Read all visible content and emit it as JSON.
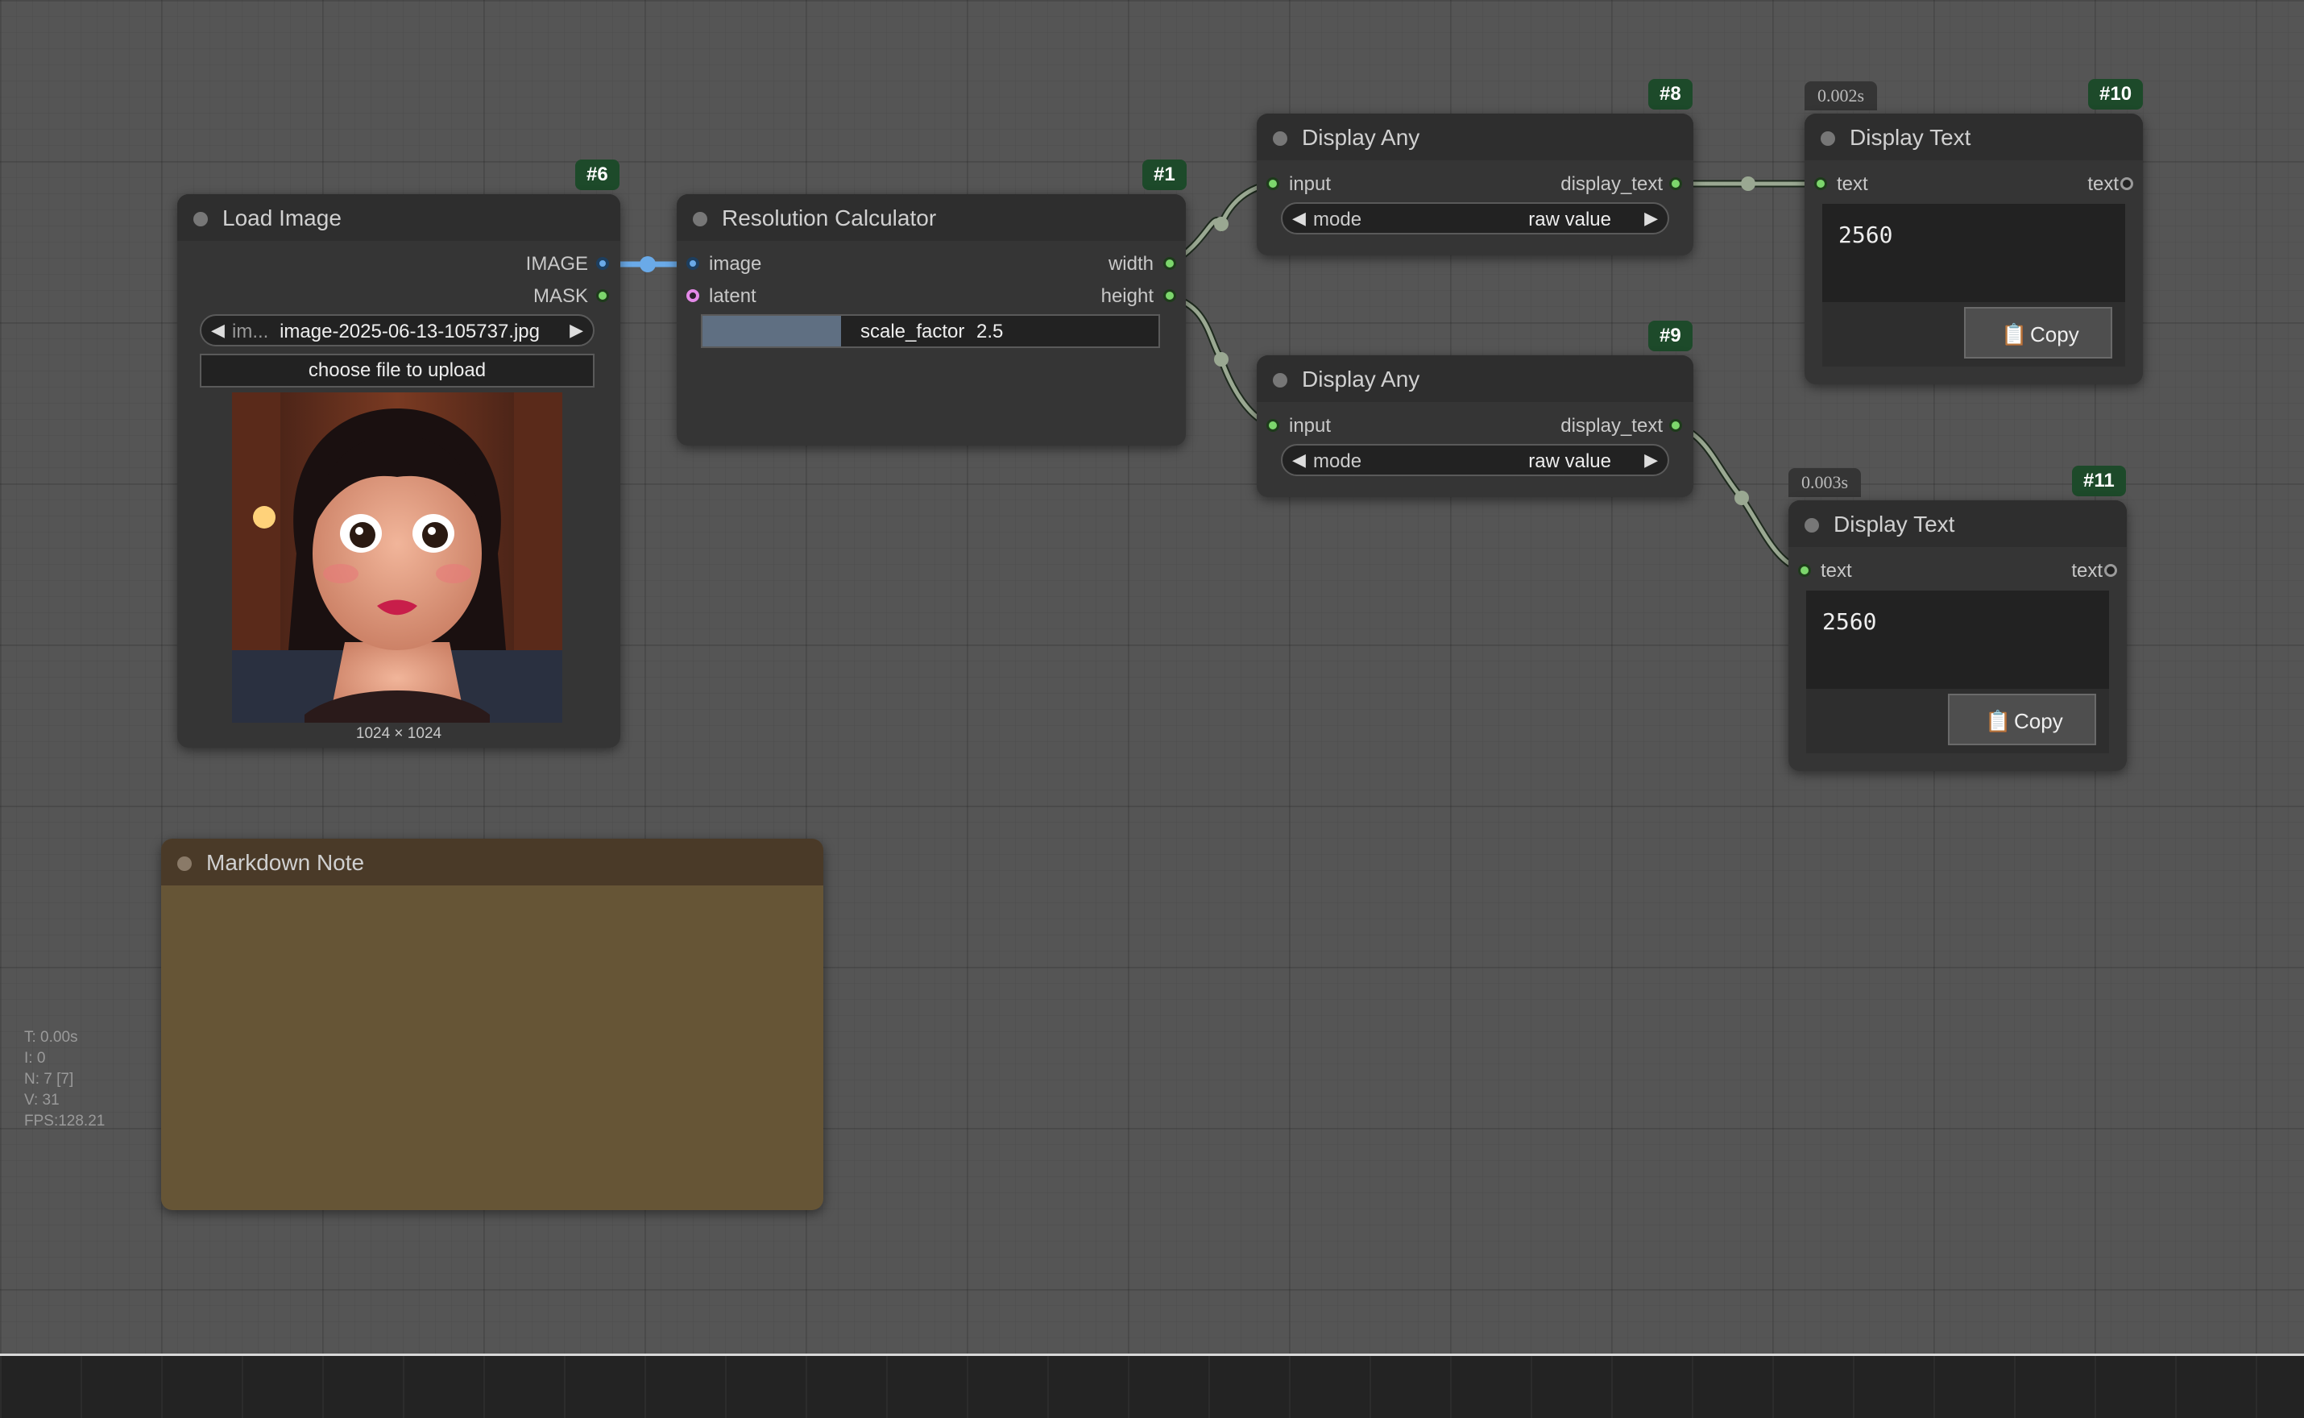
{
  "stats": {
    "time": "T: 0.00s",
    "iterations": "I: 0",
    "nodes": "N: 7 [7]",
    "vertices": "V: 31",
    "fps": "FPS:128.21"
  },
  "load_image": {
    "badge": "#6",
    "title": "Load Image",
    "outputs": [
      "IMAGE",
      "MASK"
    ],
    "image_combo_label": "im...",
    "image_combo_value": "image-2025-06-13-105737.jpg",
    "upload_label": "choose file to upload",
    "image_size": "1024 × 1024"
  },
  "resolution_calculator": {
    "badge": "#1",
    "title": "Resolution Calculator",
    "inputs": [
      "image",
      "latent"
    ],
    "outputs": [
      "width",
      "height"
    ],
    "scale_label": "scale_factor",
    "scale_value": "2.5"
  },
  "display_any_8": {
    "badge": "#8",
    "title": "Display Any",
    "input": "input",
    "output": "display_text",
    "mode_label": "mode",
    "mode_value": "raw value"
  },
  "display_any_9": {
    "badge": "#9",
    "title": "Display Any",
    "input": "input",
    "output": "display_text",
    "mode_label": "mode",
    "mode_value": "raw value"
  },
  "display_text_10": {
    "badge": "#10",
    "timer": "0.002s",
    "title": "Display Text",
    "input": "text",
    "output": "text",
    "value": "2560",
    "copy_label": "Copy"
  },
  "display_text_11": {
    "badge": "#11",
    "timer": "0.003s",
    "title": "Display Text",
    "input": "text",
    "output": "text",
    "value": "2560",
    "copy_label": "Copy"
  },
  "markdown_note": {
    "title": "Markdown Note"
  },
  "colors": {
    "canvas": "#555555",
    "node_body": "#353535",
    "node_title": "#2e2e2e",
    "badge": "#1d4a2a",
    "link_green": "#9aa892",
    "link_blue": "#6aaae8",
    "slot_green": "#7cd66c",
    "note_title": "#4a3a28",
    "note_body": "#665536"
  },
  "icons": {
    "copy": "clipboard-icon",
    "combo_left": "triangle-left-icon",
    "combo_right": "triangle-right-icon"
  }
}
